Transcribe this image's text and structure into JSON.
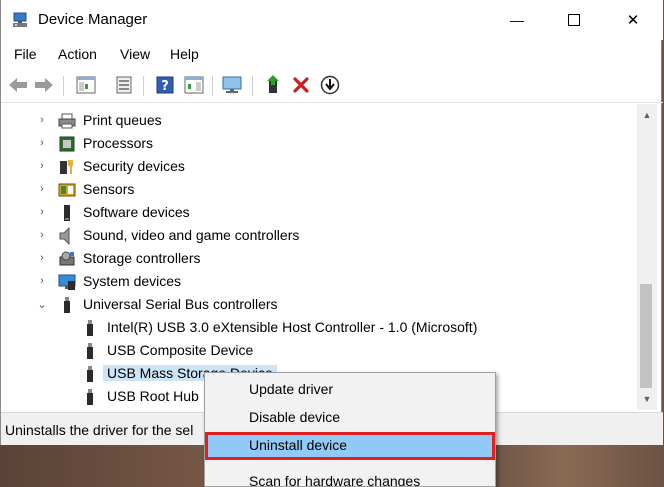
{
  "window": {
    "title": "Device Manager",
    "minimize_glyph": "—",
    "close_glyph": "✕"
  },
  "menu": [
    "File",
    "Action",
    "View",
    "Help"
  ],
  "toolbar": [
    "back-arrow-icon",
    "forward-arrow-icon",
    "properties-pane-icon",
    "device-sheet-icon",
    "help-icon",
    "action-pane-icon",
    "monitor-scan-icon",
    "update-driver-icon",
    "uninstall-x-icon",
    "download-icon"
  ],
  "tree": [
    {
      "label": "Print queues",
      "icon": "printer-icon",
      "expandable": true,
      "expanded": false,
      "level": 0
    },
    {
      "label": "Processors",
      "icon": "processor-icon",
      "expandable": true,
      "expanded": false,
      "level": 0
    },
    {
      "label": "Security devices",
      "icon": "security-key-icon",
      "expandable": true,
      "expanded": false,
      "level": 0
    },
    {
      "label": "Sensors",
      "icon": "sensors-icon",
      "expandable": true,
      "expanded": false,
      "level": 0
    },
    {
      "label": "Software devices",
      "icon": "software-device-icon",
      "expandable": true,
      "expanded": false,
      "level": 0
    },
    {
      "label": "Sound, video and game controllers",
      "icon": "speaker-icon",
      "expandable": true,
      "expanded": false,
      "level": 0
    },
    {
      "label": "Storage controllers",
      "icon": "storage-controller-icon",
      "expandable": true,
      "expanded": false,
      "level": 0
    },
    {
      "label": "System devices",
      "icon": "system-devices-icon",
      "expandable": true,
      "expanded": false,
      "level": 0
    },
    {
      "label": "Universal Serial Bus controllers",
      "icon": "usb-icon",
      "expandable": true,
      "expanded": true,
      "level": 0
    },
    {
      "label": "Intel(R) USB 3.0 eXtensible Host Controller - 1.0 (Microsoft)",
      "icon": "usb-icon",
      "expandable": false,
      "level": 1
    },
    {
      "label": "USB Composite Device",
      "icon": "usb-icon",
      "expandable": false,
      "level": 1
    },
    {
      "label": "USB Mass Storage Device",
      "icon": "usb-icon",
      "expandable": false,
      "level": 1,
      "selected": true
    },
    {
      "label": "USB Root Hub",
      "icon": "usb-icon",
      "expandable": false,
      "level": 1
    }
  ],
  "statusbar": {
    "text": "Uninstalls the driver for the sel"
  },
  "context_menu": {
    "items": [
      {
        "label": "Update driver"
      },
      {
        "label": "Disable device"
      },
      {
        "label": "Uninstall device",
        "highlighted": true
      },
      {
        "label": "Scan for hardware changes"
      }
    ]
  },
  "colors": {
    "selection": "#cce4f7",
    "menu_highlight": "#91c9f7",
    "highlight_outline": "#e02020"
  }
}
